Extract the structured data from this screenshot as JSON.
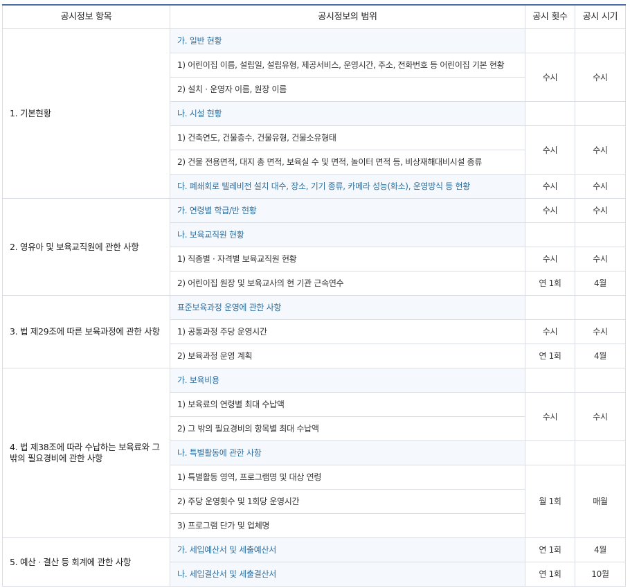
{
  "header": {
    "col_item": "공시정보 항목",
    "col_scope": "공시정보의 범위",
    "col_count": "공시 횟수",
    "col_time": "공시 시기"
  },
  "sections": [
    {
      "category": "1. 기본현황",
      "rows": [
        {
          "scope": "가. 일반 현황",
          "sub": true
        },
        {
          "scope": "1) 어린이집 이름, 설립일, 설립유형, 제공서비스, 운영시간, 주소, 전화번호 등 어린이집 기본 현황",
          "sub": false
        },
        {
          "scope": "2) 설치 · 운영자 이름, 원장 이름",
          "sub": false
        },
        {
          "scope": "나. 시설 현황",
          "sub": true
        },
        {
          "scope": "1) 건축연도, 건물층수, 건물유형, 건물소유형태",
          "sub": false
        },
        {
          "scope": "2) 건물 전용면적, 대지 총 면적, 보육실 수 및 면적, 놀이터 면적 등, 비상재해대비시설 종류",
          "sub": false
        },
        {
          "scope": "다. 폐쇄회로 텔레비전 설치 대수, 장소, 기기 종류, 카메라 성능(화소), 운영방식 등 현황",
          "sub": true
        }
      ],
      "schedule": [
        {
          "count": "수시",
          "time": "수시"
        },
        {
          "count": "수시",
          "time": "수시"
        },
        {
          "count": "수시",
          "time": "수시"
        }
      ]
    },
    {
      "category": "2. 영유아 및 보육교직원에 관한 사항",
      "rows": [
        {
          "scope": "가. 연령별 학급/반 현황",
          "sub": true
        },
        {
          "scope": "나. 보육교직원 현황",
          "sub": true
        },
        {
          "scope": "1) 직종별 · 자격별 보육교직원 현황",
          "sub": false
        },
        {
          "scope": "2) 어린이집 원장 및 보육교사의 현 기관 근속연수",
          "sub": false
        }
      ],
      "schedule": [
        {
          "count": "수시",
          "time": "수시"
        },
        {
          "count": "수시",
          "time": "수시"
        },
        {
          "count": "연 1회",
          "time": "4월"
        }
      ]
    },
    {
      "category": "3. 법 제29조에 따른 보육과정에 관한 사항",
      "rows": [
        {
          "scope": "표준보육과정 운영에 관한 사항",
          "sub": true
        },
        {
          "scope": "1) 공통과정 주당 운영시간",
          "sub": false
        },
        {
          "scope": "2) 보육과정 운영 계획",
          "sub": false
        }
      ],
      "schedule": [
        {
          "count": "수시",
          "time": "수시"
        },
        {
          "count": "연 1회",
          "time": "4월"
        }
      ]
    },
    {
      "category": "4. 법 제38조에 따라 수납하는 보육료와 그 밖의 필요경비에 관한 사항",
      "rows": [
        {
          "scope": "가. 보육비용",
          "sub": true
        },
        {
          "scope": "1) 보육료의 연령별 최대 수납액",
          "sub": false
        },
        {
          "scope": "2) 그 밖의 필요경비의 항목별 최대 수납액",
          "sub": false
        },
        {
          "scope": "나. 특별활동에 관한 사항",
          "sub": true
        },
        {
          "scope": "1) 특별활동 영역, 프로그램명 및 대상 연령",
          "sub": false
        },
        {
          "scope": "2) 주당 운영횟수 및 1회당 운영시간",
          "sub": false
        },
        {
          "scope": "3) 프로그램 단가 및 업체명",
          "sub": false
        }
      ],
      "schedule": [
        {
          "count": "수시",
          "time": "수시"
        },
        {
          "count": "월 1회",
          "time": "매월"
        }
      ]
    },
    {
      "category": "5. 예산 · 결산 등 회계에 관한 사항",
      "rows": [
        {
          "scope": "가. 세입예산서 및 세출예산서",
          "sub": true
        },
        {
          "scope": "나. 세입결산서 및 세출결산서",
          "sub": true
        }
      ],
      "schedule": [
        {
          "count": "연 1회",
          "time": "4월"
        },
        {
          "count": "연 1회",
          "time": "10월"
        }
      ]
    }
  ]
}
